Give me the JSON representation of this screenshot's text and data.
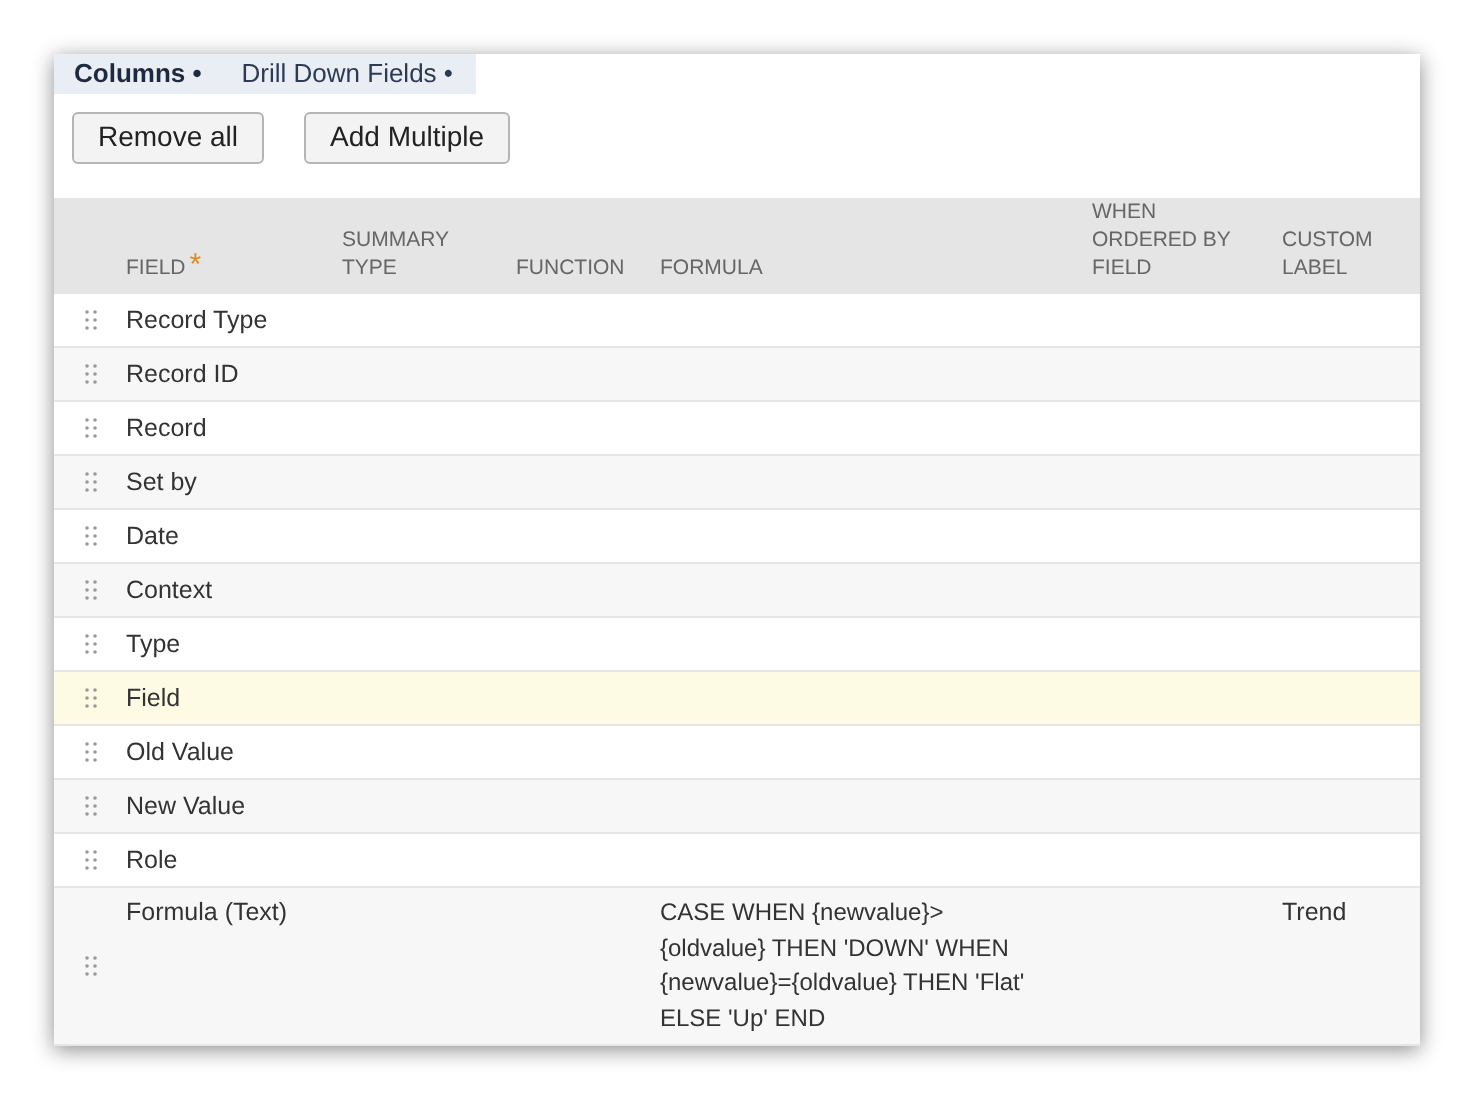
{
  "tabs": [
    {
      "label": "Columns •",
      "selected": true
    },
    {
      "label": "Drill Down Fields •",
      "selected": false
    }
  ],
  "buttons": [
    "Remove all",
    "Add Multiple"
  ],
  "table": {
    "columns": [
      {
        "label": "FIELD",
        "required_mark": "*"
      },
      {
        "label": "SUMMARY TYPE"
      },
      {
        "label": "FUNCTION"
      },
      {
        "label": "FORMULA"
      },
      {
        "label": "WHEN ORDERED BY FIELD"
      },
      {
        "label": "CUSTOM LABEL"
      }
    ],
    "rows": [
      {
        "field": "Record Type",
        "selected": false
      },
      {
        "field": "Record ID",
        "selected": false
      },
      {
        "field": "Record",
        "selected": false
      },
      {
        "field": "Set by",
        "selected": false
      },
      {
        "field": "Date",
        "selected": false
      },
      {
        "field": "Context",
        "selected": false
      },
      {
        "field": "Type",
        "selected": false
      },
      {
        "field": "Field",
        "selected": true
      },
      {
        "field": "Old Value",
        "selected": false
      },
      {
        "field": "New Value",
        "selected": false
      },
      {
        "field": "Role",
        "selected": false
      },
      {
        "field": "Formula (Text)",
        "formula": "CASE WHEN {newvalue}>\n{oldvalue} THEN 'DOWN' WHEN\n{newvalue}={oldvalue} THEN 'Flat'\nELSE 'Up' END",
        "custom_label": "Trend",
        "selected": false
      }
    ]
  }
}
